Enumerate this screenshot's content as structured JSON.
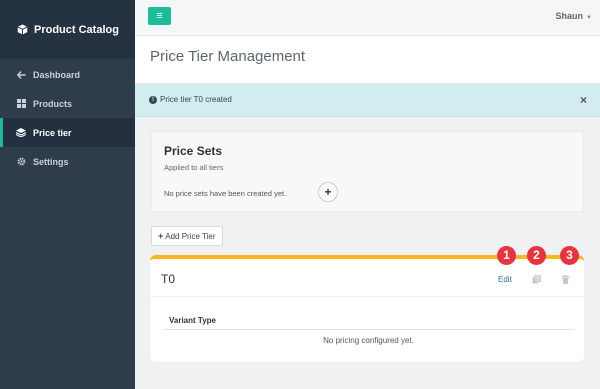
{
  "sidebar": {
    "brand": "Product Catalog",
    "items": [
      {
        "label": "Dashboard",
        "icon": "arrow-left-icon",
        "active": false
      },
      {
        "label": "Products",
        "icon": "products-grid-icon",
        "active": false
      },
      {
        "label": "Price tier",
        "icon": "layers-icon",
        "active": true
      },
      {
        "label": "Settings",
        "icon": "gear-icon",
        "active": false
      }
    ]
  },
  "topbar": {
    "menu_glyph": "≡",
    "user_name": "Shaun",
    "user_caret": "▼"
  },
  "page": {
    "title": "Price Tier Management"
  },
  "alert": {
    "message": "Price tier T0 created",
    "close": "×"
  },
  "price_sets": {
    "title": "Price Sets",
    "subtitle": "Applied to all tiers",
    "empty_text": "No price sets have been created yet.",
    "add_glyph": "+"
  },
  "add_tier_button": {
    "plus": "+",
    "label": "Add Price Tier"
  },
  "tier": {
    "name": "T0",
    "edit_label": "Edit",
    "table_header": "Variant Type",
    "empty_text": "No pricing configured yet."
  },
  "markers": [
    "1",
    "2",
    "3"
  ],
  "colors": {
    "sidebar_bg": "#2f3d4b",
    "accent": "#1abc9c",
    "alert_bg": "#d2ecef",
    "tier_border": "#f6b81c",
    "marker": "#e8343f",
    "link": "#2c6fb5"
  }
}
